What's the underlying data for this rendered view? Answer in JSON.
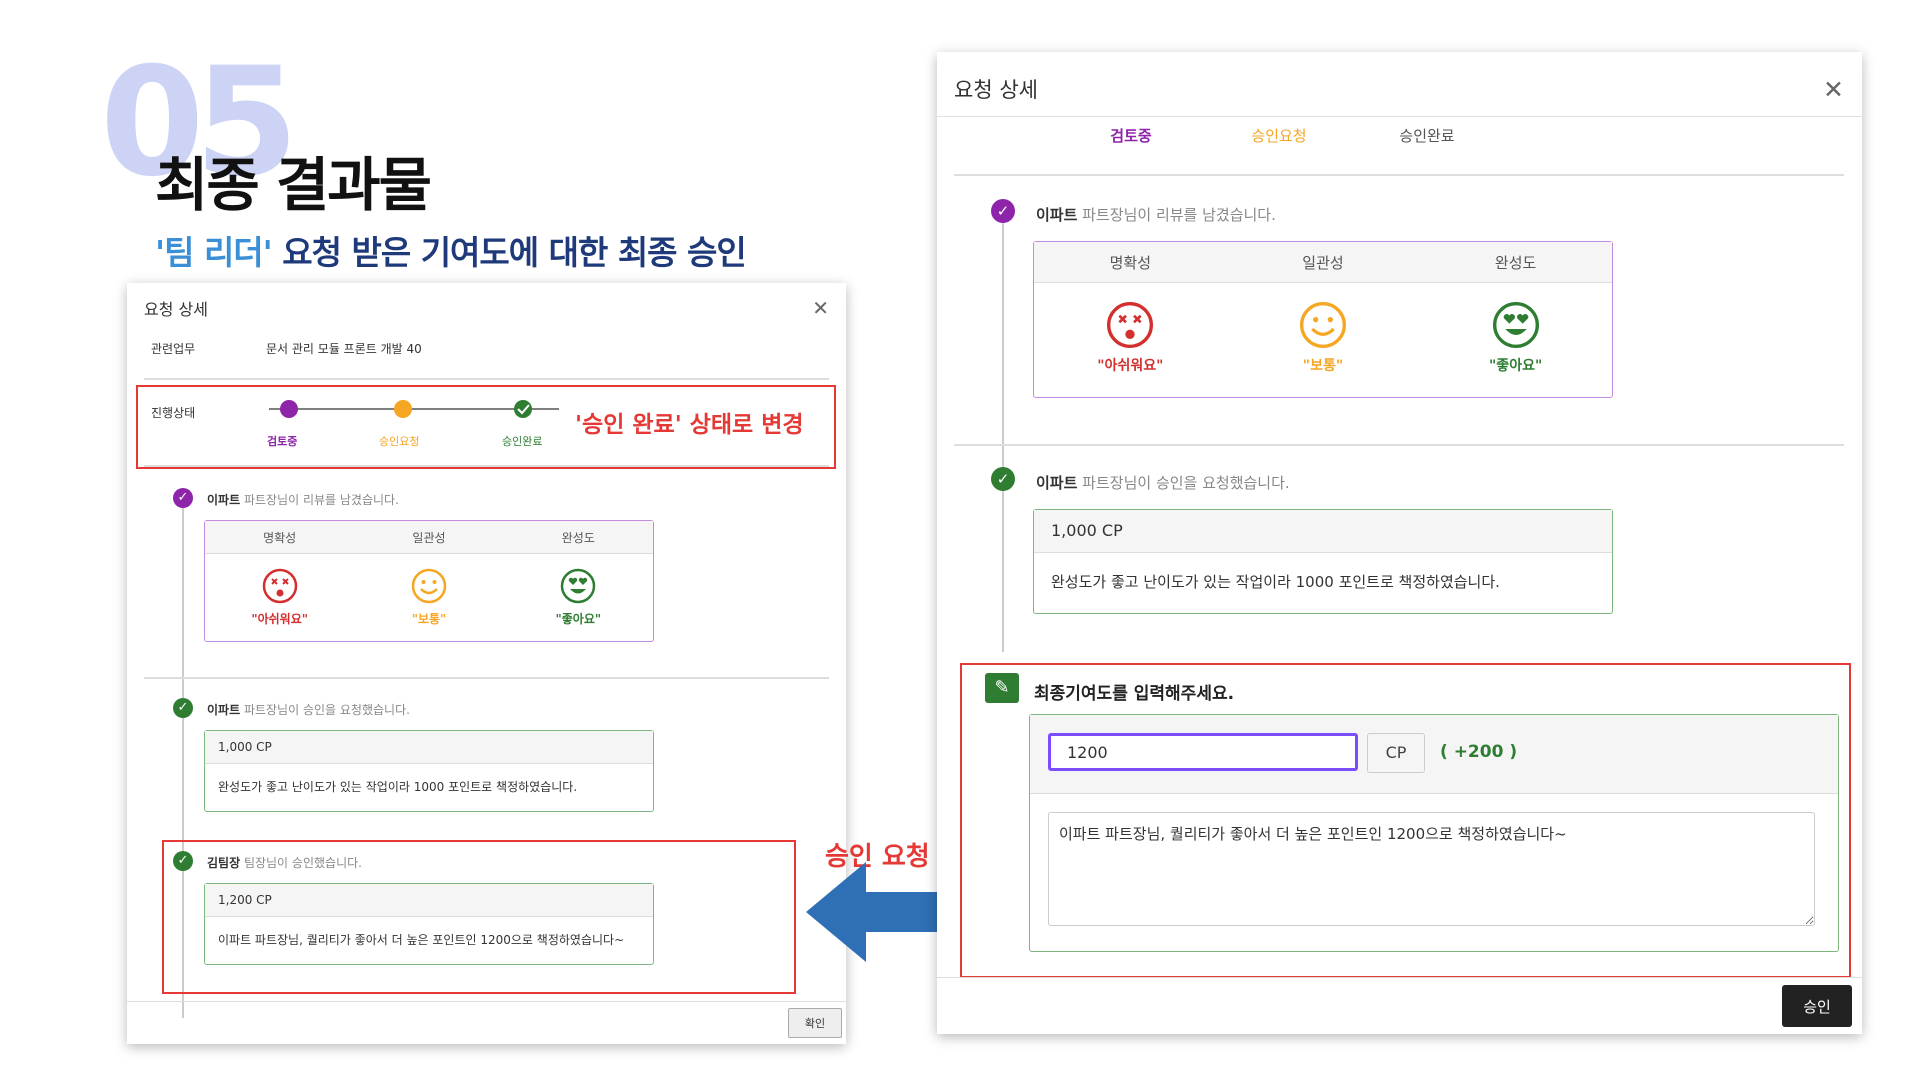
{
  "slide": {
    "number": "05",
    "title": "최종 결과물",
    "subtitle_highlight": "'팀 리더'",
    "subtitle_rest": " 요청 받은 기여도에 대한 최종 승인"
  },
  "annotations": {
    "status_change": "'승인 완료' 상태로 변경",
    "approval_request": "승인 요청"
  },
  "left_dialog": {
    "title": "요청 상세",
    "related_label": "관련업무",
    "related_value": "문서 관리 모듈 프론트 개발 40",
    "progress_label": "진행상태",
    "steps": [
      "검토중",
      "승인요청",
      "승인완료"
    ],
    "review": {
      "author": "이파트",
      "text": " 파트장님이 리뷰를 남겼습니다."
    },
    "criteria": [
      "명확성",
      "일관성",
      "완성도"
    ],
    "ratings": [
      "\"아쉬워요\"",
      "\"보통\"",
      "\"좋아요\""
    ],
    "request": {
      "author": "이파트",
      "text": " 파트장님이 승인을 요청했습니다.",
      "points": "1,000 CP",
      "comment": "완성도가 좋고 난이도가 있는 작업이라 1000 포인트로 책정하였습니다."
    },
    "approval": {
      "author": "김팀장",
      "text": " 팀장님이 승인했습니다.",
      "points": "1,200 CP",
      "comment": "이파트 파트장님, 퀄리티가 좋아서 더 높은 포인트인 1200으로 책정하였습니다~"
    },
    "confirm_button": "확인"
  },
  "right_dialog": {
    "title": "요청 상세",
    "tabs": [
      "검토중",
      "승인요청",
      "승인완료"
    ],
    "review": {
      "author": "이파트",
      "text": " 파트장님이 리뷰를 남겼습니다."
    },
    "criteria": [
      "명확성",
      "일관성",
      "완성도"
    ],
    "ratings": [
      "\"아쉬워요\"",
      "\"보통\"",
      "\"좋아요\""
    ],
    "request": {
      "author": "이파트",
      "text": " 파트장님이 승인을 요청했습니다.",
      "points": "1,000 CP",
      "comment": "완성도가 좋고 난이도가 있는 작업이라 1000 포인트로 책정하였습니다."
    },
    "final_input": {
      "prompt": "최종기여도를 입력해주세요.",
      "value": "1200",
      "unit": "CP",
      "diff": "( +200 )",
      "comment": "이파트 파트장님, 퀄리티가 좋아서 더 높은 포인트인 1200으로 책정하였습니다~"
    },
    "approve_button": "승인"
  },
  "colors": {
    "purple": "#8e24aa",
    "orange": "#f5a623",
    "green": "#2e7d32",
    "red": "#d32f2f",
    "annotation_red": "#e53935",
    "arrow_blue": "#2f6fb5"
  },
  "icons": [
    "check-circle-icon",
    "dizzy-face-icon",
    "smile-face-icon",
    "heart-eyes-face-icon",
    "edit-note-icon",
    "close-icon",
    "left-arrow-icon"
  ]
}
